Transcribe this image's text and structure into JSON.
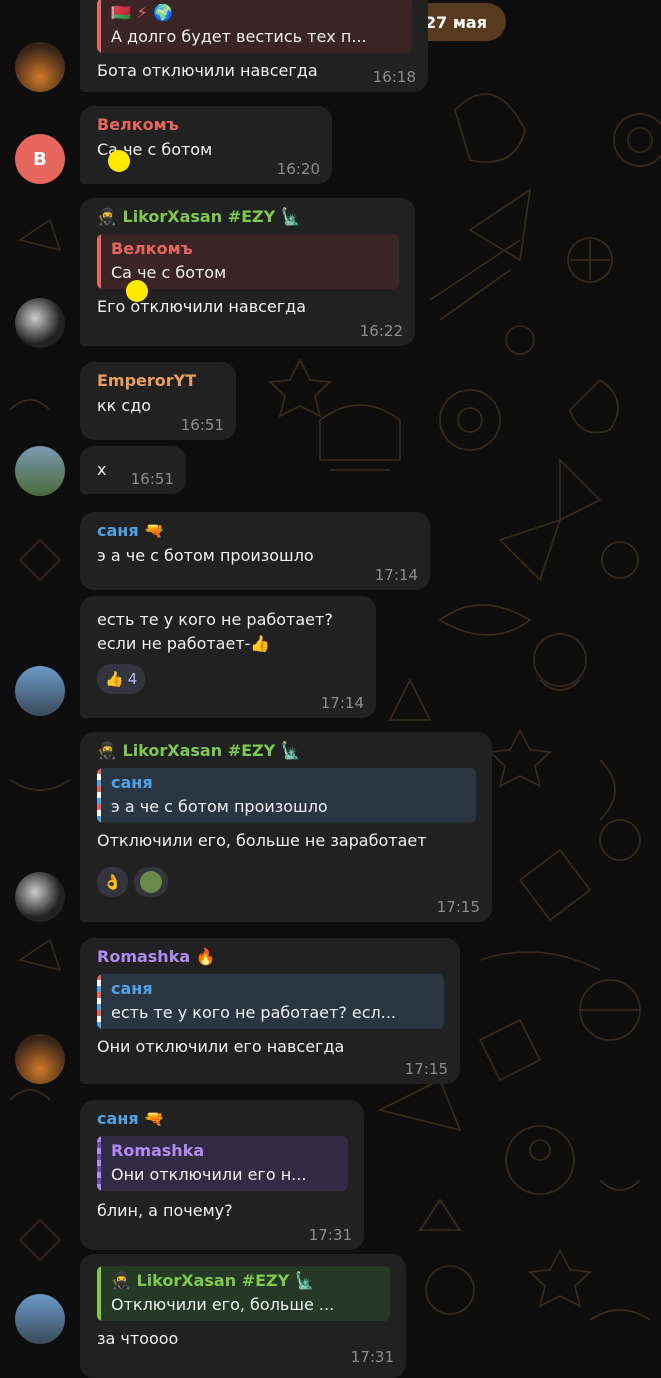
{
  "date_pill": "27 мая",
  "colors": {
    "bubble": "#212121",
    "name_red": "#e5675d",
    "name_green": "#7ecb4c",
    "name_orange": "#e8a05b",
    "name_blue": "#4fa3e8",
    "name_purple": "#b18cf0",
    "time": "#8d8d8d"
  },
  "messages": [
    {
      "quote_text": "А долго будет вестись тех п...",
      "text": "Бота отключили навсегда",
      "time": "16:18"
    },
    {
      "name": "Велкомъ",
      "text": "Са че с ботом",
      "time": "16:20",
      "avatar_letter": "В"
    },
    {
      "name": "LikorXasan #EZY",
      "quote_name": "Велкомъ",
      "quote_text": "Са че с ботом",
      "text": "Его отключили навсегда",
      "time": "16:22"
    },
    {
      "name": "EmperorYT",
      "text": "кк сдо",
      "time": "16:51"
    },
    {
      "text": "х",
      "time": "16:51"
    },
    {
      "name": "саня",
      "text": "э а че с ботом произошло",
      "time": "17:14"
    },
    {
      "text_line1": "есть те у кого не работает?",
      "text_line2": "если не работает-",
      "reaction_count": "4",
      "time": "17:14"
    },
    {
      "name": "LikorXasan #EZY",
      "quote_name": "саня",
      "quote_text": "э а че с ботом произошло",
      "text": "Отключили его, больше не заработает",
      "time": "17:15"
    },
    {
      "name": "Romashka",
      "quote_name": "саня",
      "quote_text": "есть те у кого не работает? есл...",
      "text": "Они отключили его навсегда",
      "time": "17:15"
    },
    {
      "name": "саня",
      "quote_name": "Romashka",
      "quote_text": "Они отключили его н...",
      "text": "блин, а почему?",
      "time": "17:31"
    },
    {
      "quote_name": "LikorXasan #EZY",
      "quote_text": "Отключили его, больше ...",
      "text": "за чтоооо",
      "time": "17:31"
    }
  ]
}
